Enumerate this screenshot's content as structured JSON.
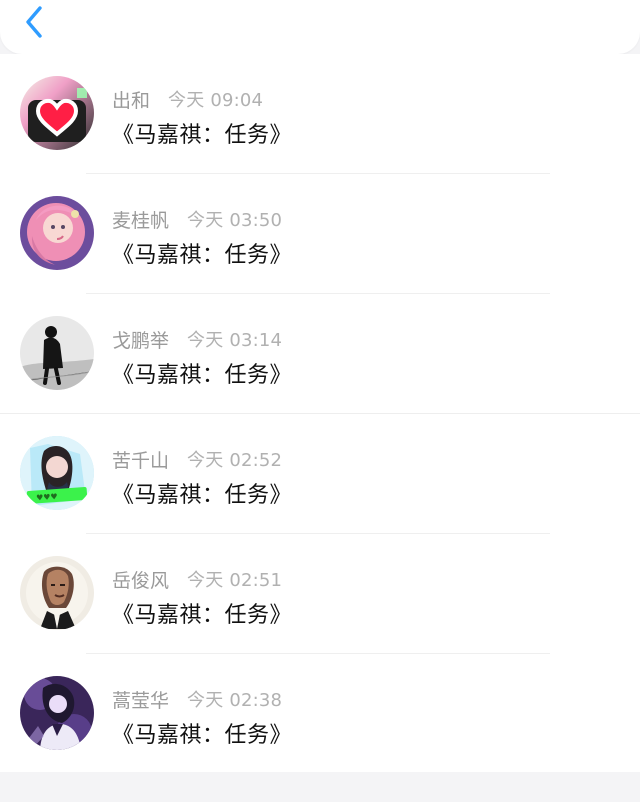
{
  "header": {
    "back_icon": "chevron-left-icon",
    "accent_color": "#2f9cff"
  },
  "messages": [
    {
      "sender": "出和",
      "time": "今天 09:04",
      "text": "《马嘉祺：任务》",
      "avatar_icon": "heart-avatar-icon"
    },
    {
      "sender": "麦桂帆",
      "time": "今天 03:50",
      "text": "《马嘉祺：任务》",
      "avatar_icon": "pink-hair-avatar-icon"
    },
    {
      "sender": "戈鹏举",
      "time": "今天 03:14",
      "text": "《马嘉祺：任务》",
      "avatar_icon": "silhouette-avatar-icon"
    },
    {
      "sender": "苦千山",
      "time": "今天 02:52",
      "text": "《马嘉祺：任务》",
      "avatar_icon": "girl-photo-avatar-icon"
    },
    {
      "sender": "岳俊风",
      "time": "今天 02:51",
      "text": "《马嘉祺：任务》",
      "avatar_icon": "portrait-avatar-icon"
    },
    {
      "sender": "蒿莹华",
      "time": "今天 02:38",
      "text": "《马嘉祺：任务》",
      "avatar_icon": "purple-avatar-icon"
    }
  ]
}
